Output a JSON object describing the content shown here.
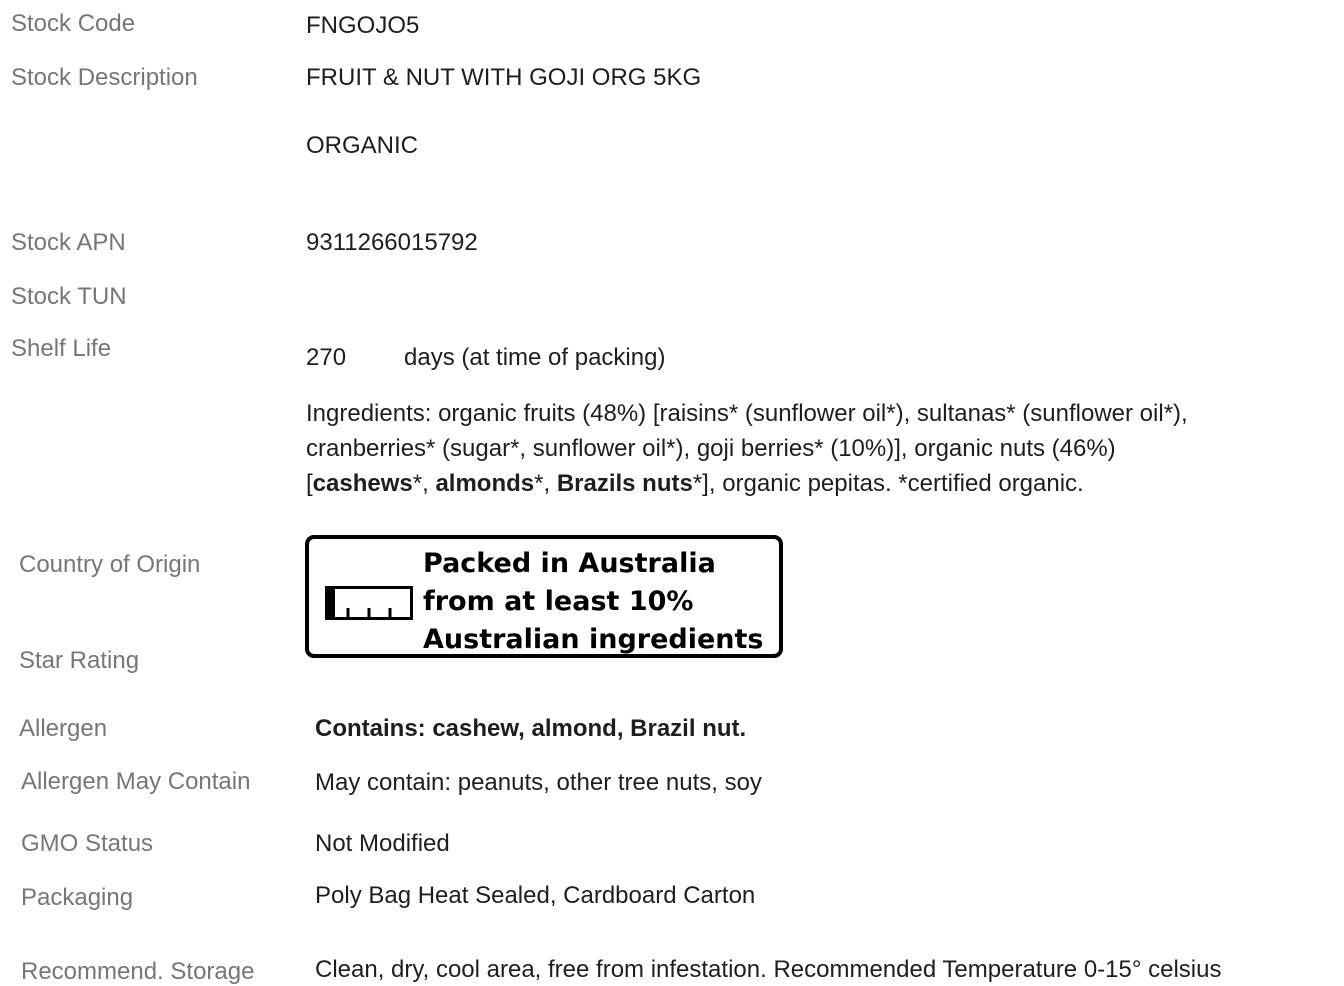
{
  "fields": {
    "stock_code": {
      "label": "Stock Code",
      "value": "FNGOJO5"
    },
    "stock_description": {
      "label": "Stock Description",
      "value": "FRUIT & NUT WITH GOJI ORG  5KG",
      "value2": "ORGANIC"
    },
    "stock_apn": {
      "label": "Stock APN",
      "value": "9311266015792"
    },
    "stock_tun": {
      "label": "Stock TUN",
      "value": ""
    },
    "shelf_life": {
      "label": "Shelf Life",
      "days": "270",
      "unit_text": "days (at time of packing)"
    },
    "ingredients": {
      "line1": "Ingredients: organic fruits (48%) [raisins* (sunflower oil*), sultanas* (sunflower oil*),",
      "line2": "cranberries* (sugar*, sunflower oil*), goji berries* (10%)], organic nuts (46%)",
      "line3_open": "[",
      "line3_cashews": "cashews",
      "line3_sep1": "*, ",
      "line3_almonds": "almonds",
      "line3_sep2": "*, ",
      "line3_brazils": "Brazils nuts",
      "line3_rest": "*], organic pepitas. *certified organic."
    },
    "country_of_origin": {
      "label": "Country of Origin",
      "logo_line1": "Packed in Australia",
      "logo_line2": "from at least 10%",
      "logo_line3": "Australian ingredients",
      "australian_fraction": 0.1
    },
    "star_rating": {
      "label": "Star Rating",
      "value": ""
    },
    "allergen": {
      "label": "Allergen",
      "value": "Contains: cashew, almond, Brazil nut."
    },
    "allergen_may_contain": {
      "label": "Allergen May Contain",
      "value": "May contain: peanuts, other tree nuts, soy"
    },
    "gmo_status": {
      "label": "GMO Status",
      "value": "Not Modified"
    },
    "packaging": {
      "label": "Packaging",
      "value": "Poly Bag Heat Sealed, Cardboard Carton"
    },
    "recommended_storage": {
      "label": "Recommend. Storage",
      "value": "Clean, dry, cool area, free from infestation. Recommended Temperature 0-15° celsius"
    }
  }
}
